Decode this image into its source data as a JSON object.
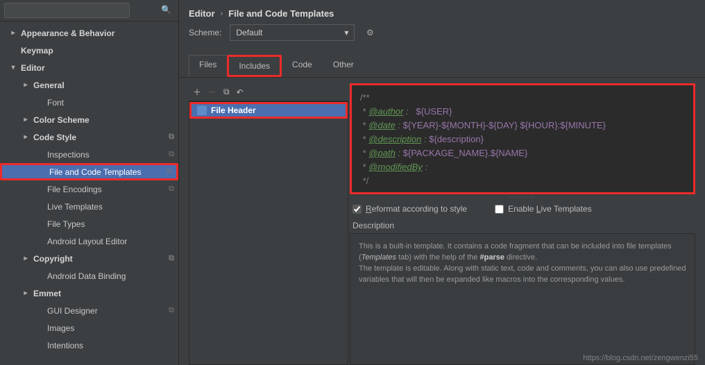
{
  "search": {
    "placeholder": ""
  },
  "sidebar": {
    "items": [
      {
        "label": "Appearance & Behavior",
        "lvl": 0,
        "arr": "right",
        "copy": false
      },
      {
        "label": "Keymap",
        "lvl": 0,
        "arr": "none",
        "copy": false
      },
      {
        "label": "Editor",
        "lvl": 0,
        "arr": "down",
        "copy": false
      },
      {
        "label": "General",
        "lvl": 1,
        "arr": "right",
        "copy": false
      },
      {
        "label": "Font",
        "lvl": 2,
        "arr": "none",
        "copy": false
      },
      {
        "label": "Color Scheme",
        "lvl": 1,
        "arr": "right",
        "copy": false
      },
      {
        "label": "Code Style",
        "lvl": 1,
        "arr": "right",
        "copy": true
      },
      {
        "label": "Inspections",
        "lvl": 2,
        "arr": "none",
        "copy": true
      },
      {
        "label": "File and Code Templates",
        "lvl": 2,
        "arr": "none",
        "copy": true,
        "selected": true
      },
      {
        "label": "File Encodings",
        "lvl": 2,
        "arr": "none",
        "copy": true
      },
      {
        "label": "Live Templates",
        "lvl": 2,
        "arr": "none",
        "copy": false
      },
      {
        "label": "File Types",
        "lvl": 2,
        "arr": "none",
        "copy": false
      },
      {
        "label": "Android Layout Editor",
        "lvl": 2,
        "arr": "none",
        "copy": false
      },
      {
        "label": "Copyright",
        "lvl": 1,
        "arr": "right",
        "copy": true
      },
      {
        "label": "Android Data Binding",
        "lvl": 2,
        "arr": "none",
        "copy": false
      },
      {
        "label": "Emmet",
        "lvl": 1,
        "arr": "right",
        "copy": false
      },
      {
        "label": "GUI Designer",
        "lvl": 2,
        "arr": "none",
        "copy": true
      },
      {
        "label": "Images",
        "lvl": 2,
        "arr": "none",
        "copy": false
      },
      {
        "label": "Intentions",
        "lvl": 2,
        "arr": "none",
        "copy": false
      }
    ]
  },
  "breadcrumb": {
    "a": "Editor",
    "b": "File and Code Templates"
  },
  "scheme": {
    "label": "Scheme:",
    "value": "Default"
  },
  "tabs": [
    "Files",
    "Includes",
    "Code",
    "Other"
  ],
  "list": {
    "item": "File Header"
  },
  "code": {
    "l1": "/**",
    "l2": " * ",
    "t2": "@author",
    "r2": " :   ",
    "v2": "${USER}",
    "l3": " * ",
    "t3": "@date",
    "r3": " : ",
    "v3": "${YEAR}-${MONTH}-${DAY} ${HOUR}:${MINUTE}",
    "l4": " * ",
    "t4": "@description",
    "r4": " : ",
    "v4": "${description}",
    "l5": " * ",
    "t5": "@path",
    "r5": " : ",
    "v5": "${PACKAGE_NAME}.${NAME}",
    "l6": " * ",
    "t6": "@modifiedBy",
    "r6": " :",
    "l7": " */"
  },
  "checks": {
    "reformat_prefix": "R",
    "reformat": "eformat according to style",
    "enable_prefix": "Enable ",
    "enable_u": "L",
    "enable_rest": "ive Templates"
  },
  "desc": {
    "label": "Description",
    "p1a": "This is a built-in template. It contains a code fragment that can be included into file templates (",
    "p1i": "Templates",
    "p1b": " tab) with the help of the ",
    "p1c": "#parse",
    "p1d": " directive.",
    "p2": "The template is editable. Along with static text, code and comments, you can also use predefined variables that will then be expanded like macros into the corresponding values."
  },
  "watermark": "https://blog.csdn.net/zengwenzi55"
}
